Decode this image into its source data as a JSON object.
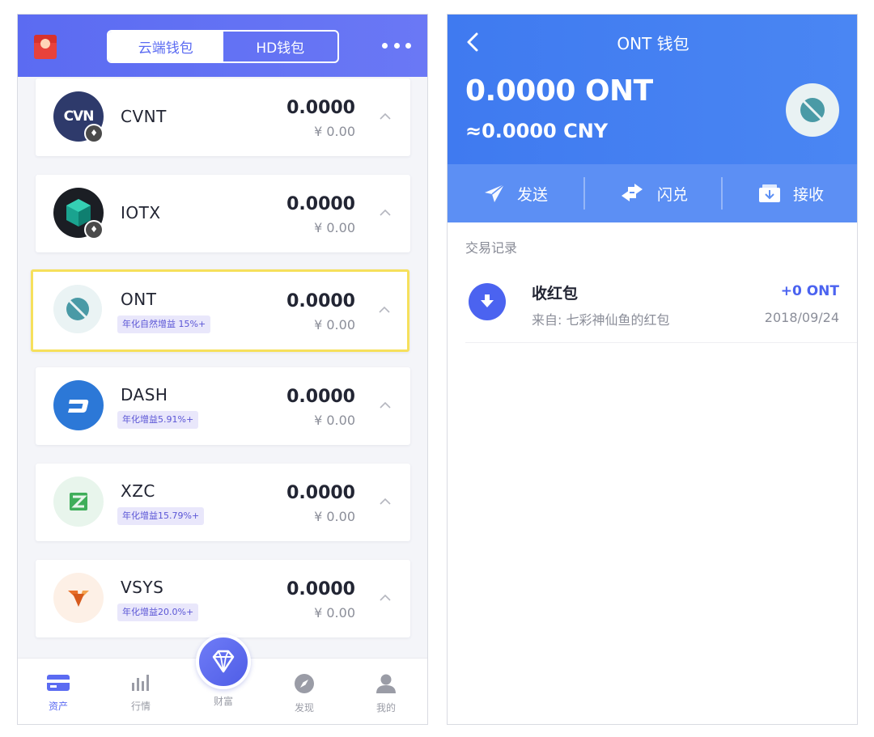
{
  "left": {
    "tabs": {
      "cloud": "云端钱包",
      "hd": "HD钱包"
    },
    "coins": [
      {
        "name": "CVNT",
        "logo_text": "CVN",
        "amount": "0.0000",
        "cny": "¥ 0.00",
        "yield": ""
      },
      {
        "name": "IOTX",
        "amount": "0.0000",
        "cny": "¥ 0.00",
        "yield": ""
      },
      {
        "name": "ONT",
        "amount": "0.0000",
        "cny": "¥ 0.00",
        "yield": "年化自然增益 15%+"
      },
      {
        "name": "DASH",
        "amount": "0.0000",
        "cny": "¥ 0.00",
        "yield": "年化增益5.91%+"
      },
      {
        "name": "XZC",
        "amount": "0.0000",
        "cny": "¥ 0.00",
        "yield": "年化增益15.79%+"
      },
      {
        "name": "VSYS",
        "amount": "0.0000",
        "cny": "¥ 0.00",
        "yield": "年化增益20.0%+"
      }
    ],
    "nav": {
      "assets": "资产",
      "market": "行情",
      "wealth": "财富",
      "discover": "发现",
      "me": "我的"
    }
  },
  "right": {
    "title": "ONT 钱包",
    "balance_ont": "0.0000 ONT",
    "balance_cny": "≈0.0000 CNY",
    "actions": {
      "send": "发送",
      "swap": "闪兑",
      "receive": "接收"
    },
    "tx_section": "交易记录",
    "tx": {
      "title": "收红包",
      "from": "来自: 七彩神仙鱼的红包",
      "amount": "+0 ONT",
      "date": "2018/09/24"
    }
  },
  "colors": {
    "accent": "#5b6bf2",
    "header_blue": "#3f7af0",
    "highlight": "#f6e05c"
  }
}
